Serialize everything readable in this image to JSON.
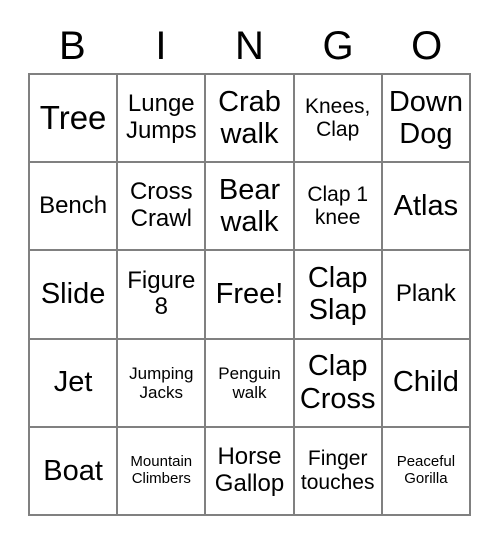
{
  "card": {
    "header_letters": [
      "B",
      "I",
      "N",
      "G",
      "O"
    ],
    "free_space_label": "Free!",
    "colors": {
      "border": "#808080",
      "text": "#000000",
      "background": "#ffffff"
    },
    "rows": [
      [
        {
          "text": "Tree",
          "size": "xl"
        },
        {
          "text": "Lunge Jumps",
          "size": "md"
        },
        {
          "text": "Crab walk",
          "size": "lg"
        },
        {
          "text": "Knees, Clap",
          "size": "sm"
        },
        {
          "text": "Down Dog",
          "size": "lg"
        }
      ],
      [
        {
          "text": "Bench",
          "size": "md"
        },
        {
          "text": "Cross Crawl",
          "size": "md"
        },
        {
          "text": "Bear walk",
          "size": "lg"
        },
        {
          "text": "Clap 1 knee",
          "size": "sm"
        },
        {
          "text": "Atlas",
          "size": "lg"
        }
      ],
      [
        {
          "text": "Slide",
          "size": "lg"
        },
        {
          "text": "Figure 8",
          "size": "md"
        },
        {
          "text": "Free!",
          "size": "lg"
        },
        {
          "text": "Clap Slap",
          "size": "lg"
        },
        {
          "text": "Plank",
          "size": "md"
        }
      ],
      [
        {
          "text": "Jet",
          "size": "lg"
        },
        {
          "text": "Jumping Jacks",
          "size": "xs"
        },
        {
          "text": "Penguin walk",
          "size": "xs"
        },
        {
          "text": "Clap Cross",
          "size": "lg"
        },
        {
          "text": "Child",
          "size": "lg"
        }
      ],
      [
        {
          "text": "Boat",
          "size": "lg"
        },
        {
          "text": "Mountain Climbers",
          "size": "xxs"
        },
        {
          "text": "Horse Gallop",
          "size": "md"
        },
        {
          "text": "Finger touches",
          "size": "sm"
        },
        {
          "text": "Peaceful Gorilla",
          "size": "xxs"
        }
      ]
    ]
  }
}
